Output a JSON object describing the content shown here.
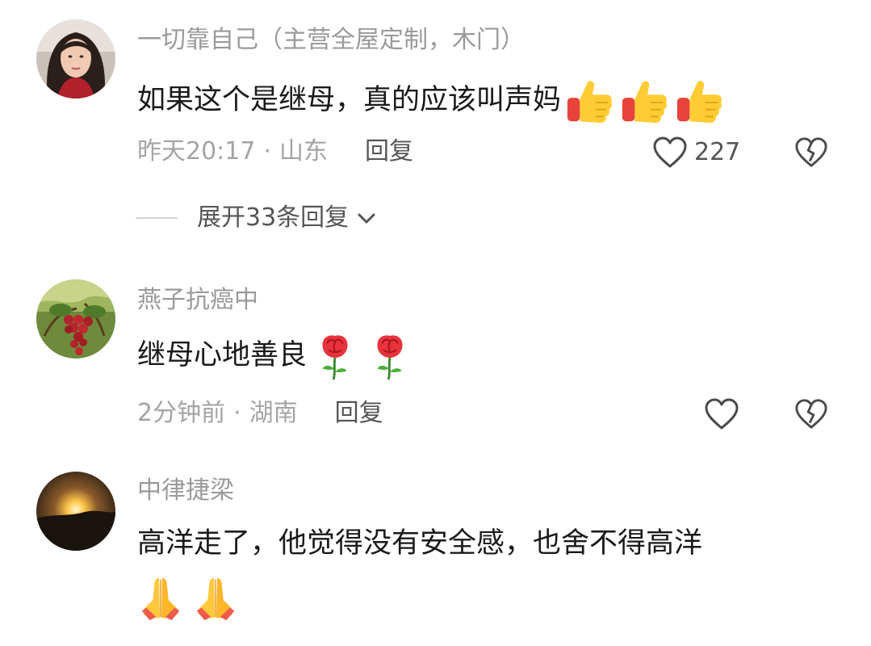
{
  "comments": [
    {
      "username": "一切靠自己（主营全屋定制，木门）",
      "text": "如果这个是继母，真的应该叫声妈",
      "emojis": [
        "thumbs-up",
        "thumbs-up",
        "thumbs-up"
      ],
      "time": "昨天20:17",
      "location": "山东",
      "reply_label": "回复",
      "like_count": "227",
      "expand_label": "展开33条回复"
    },
    {
      "username": "燕子抗癌中",
      "text": "继母心地善良",
      "emojis": [
        "rose",
        "rose"
      ],
      "time": "2分钟前",
      "location": "湖南",
      "reply_label": "回复",
      "like_count": ""
    },
    {
      "username": "中律捷梁",
      "text": "高洋走了，他觉得没有安全感，也舍不得高洋",
      "emojis": [
        "folded-hands",
        "folded-hands"
      ]
    }
  ],
  "separator": "·",
  "colors": {
    "username": "#9a9a9a",
    "meta": "#a4a4a4",
    "reply": "#555555",
    "text": "#1a1a1a"
  }
}
